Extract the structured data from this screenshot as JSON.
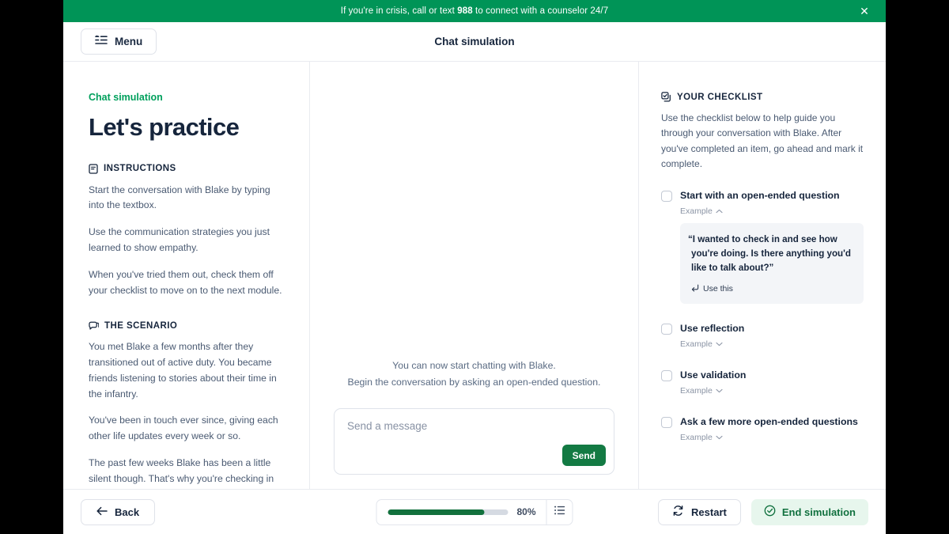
{
  "banner": {
    "text_prefix": "If you're in crisis, call or text ",
    "text_bold": "988",
    "text_suffix": " to connect with a counselor 24/7",
    "close_label": "✕",
    "bg_color": "#009457"
  },
  "topbar": {
    "menu_label": "Menu",
    "title": "Chat simulation"
  },
  "left": {
    "eyebrow": "Chat simulation",
    "title": "Let's practice",
    "instructions_heading": "INSTRUCTIONS",
    "instructions": [
      "Start the conversation with Blake by typing into the textbox.",
      "Use the communication strategies you just learned to show empathy.",
      "When you've tried them out, check them off your checklist to move on to the next module."
    ],
    "scenario_heading": "THE SCENARIO",
    "scenario": [
      "You met Blake a few months after they transitioned out of active duty. You became friends listening to stories about their time in the infantry.",
      "You've been in touch ever since, giving each other life updates every week or so.",
      "The past few weeks Blake has been a little silent though. That's why you're checking in with them."
    ]
  },
  "center": {
    "hint_line1": "You can now start chatting with Blake.",
    "hint_line2": "Begin the conversation by asking an open-ended question.",
    "composer_placeholder": "Send a message",
    "composer_value": "",
    "send_label": "Send"
  },
  "checklist": {
    "heading": "YOUR CHECKLIST",
    "intro": "Use the checklist below to help guide you through your conversation with Blake. After you've completed an item, go ahead and mark it complete.",
    "items": [
      {
        "label": "Start with an open-ended question",
        "example_label": "Example",
        "expanded": true,
        "example_text": "“I wanted to check in and see how you're doing. Is there anything you'd like to talk about?”",
        "use_this_label": "Use this",
        "checked": false
      },
      {
        "label": "Use reflection",
        "example_label": "Example",
        "expanded": false,
        "checked": false
      },
      {
        "label": "Use validation",
        "example_label": "Example",
        "expanded": false,
        "checked": false
      },
      {
        "label": "Ask a few more open-ended questions",
        "example_label": "Example",
        "expanded": false,
        "checked": false
      }
    ]
  },
  "bottombar": {
    "back_label": "Back",
    "progress_percent": "80%",
    "progress_value": 80,
    "restart_label": "Restart",
    "end_label": "End simulation"
  },
  "colors": {
    "brand_green": "#009457",
    "accent_green": "#00a05c",
    "progress_green": "#12713d",
    "send_green": "#137a43",
    "end_bg": "#e7f6ed",
    "text_dark": "#16253c",
    "text_muted": "#4a5a72"
  }
}
